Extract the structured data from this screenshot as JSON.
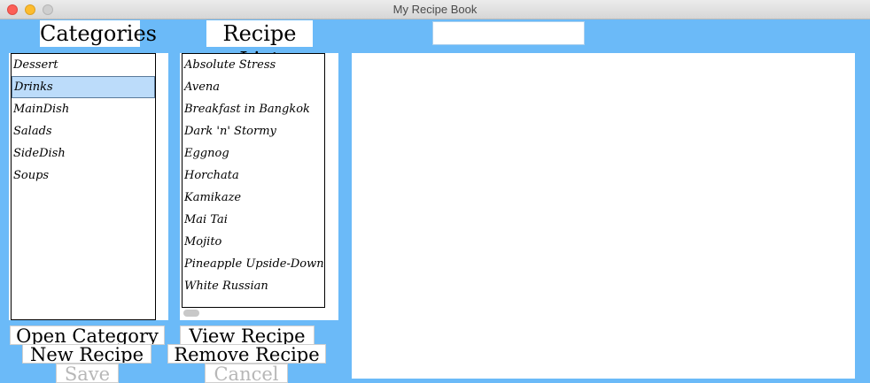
{
  "window": {
    "title": "My Recipe Book"
  },
  "headers": {
    "categories": "Categories",
    "recipe_list": "Recipe List"
  },
  "search": {
    "value": ""
  },
  "categories": [
    {
      "label": "Dessert"
    },
    {
      "label": "Drinks",
      "selected": true
    },
    {
      "label": "MainDish"
    },
    {
      "label": "Salads"
    },
    {
      "label": "SideDish"
    },
    {
      "label": "Soups"
    }
  ],
  "recipes": [
    {
      "label": "Absolute Stress"
    },
    {
      "label": "Avena"
    },
    {
      "label": "Breakfast in Bangkok"
    },
    {
      "label": "Dark 'n' Stormy"
    },
    {
      "label": "Eggnog"
    },
    {
      "label": "Horchata"
    },
    {
      "label": "Kamikaze"
    },
    {
      "label": "Mai Tai"
    },
    {
      "label": "Mojito"
    },
    {
      "label": "Pineapple Upside-Down C"
    },
    {
      "label": "White Russian"
    }
  ],
  "buttons": {
    "open_category": "Open Category",
    "view_recipe": "View Recipe",
    "new_recipe": "New Recipe",
    "remove_recipe": "Remove Recipe",
    "save": "Save",
    "cancel": "Cancel"
  }
}
